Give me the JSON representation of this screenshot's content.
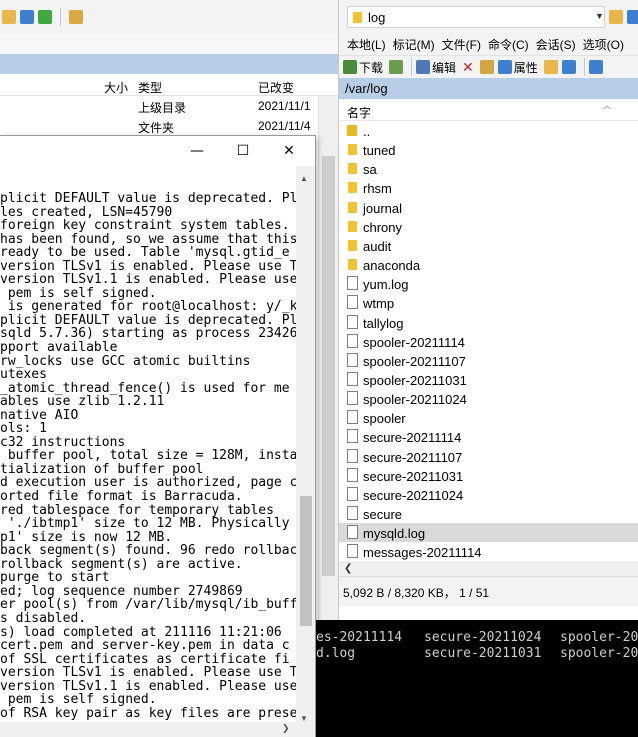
{
  "left_browser": {
    "columns": {
      "size": "大小",
      "type": "类型",
      "modified": "已改变"
    },
    "rows": [
      {
        "type": "上级目录",
        "modified": "2021/11/1"
      },
      {
        "type": "文件夹",
        "modified": "2021/11/4"
      }
    ]
  },
  "console": {
    "minimize_glyph": "—",
    "maximize_glyph": "☐",
    "close_glyph": "✕",
    "lines": [
      "plicit DEFAULT value is deprecated. Pl",
      "les created, LSN=45790",
      "foreign key constraint system tables.",
      "has been found, so we assume that this",
      "ready to be used. Table 'mysql.gtid_e",
      "version TLSv1 is enabled. Please use T",
      "version TLSv1.1 is enabled. Please use",
      " pem is self signed.",
      " is generated for root@localhost: y/_k",
      "plicit DEFAULT value is deprecated. Pl",
      "sqld 5.7.36) starting as process 23426",
      "pport available",
      "rw_locks use GCC atomic builtins",
      "utexes",
      "_atomic_thread_fence() is used for me",
      "ables use zlib 1.2.11",
      "native AIO",
      "ols: 1",
      "c32 instructions",
      " buffer pool, total size = 128M, insta",
      "tialization of buffer pool",
      "d execution user is authorized, page c",
      "orted file format is Barracuda.",
      "red tablespace for temporary tables",
      " './ibtmp1' size to 12 MB. Physically",
      "p1' size is now 12 MB.",
      "back segment(s) found. 96 redo rollbac",
      "rollback segment(s) are active.",
      "purge to start",
      "ed; log sequence number 2749869",
      "er pool(s) from /var/lib/mysql/ib_buff",
      "s disabled.",
      "s) load completed at 211116 11:21:06",
      "cert.pem and server-key.pem in data c",
      "of SSL certificates as certificate fi",
      "version TLSv1 is enabled. Please use T",
      "version TLSv1.1 is enabled. Please use",
      " pem is self signed.",
      "of RSA key pair as key files are prese"
    ]
  },
  "remote_browser": {
    "address": "log",
    "menu": [
      "本地(L)",
      "标记(M)",
      "文件(F)",
      "命令(C)",
      "会话(S)",
      "选项(O)"
    ],
    "actions": {
      "download": "下载",
      "edit": "编辑",
      "properties": "属性"
    },
    "path": "/var/log",
    "column_name": "名字",
    "files": [
      {
        "name": "..",
        "kind": "up"
      },
      {
        "name": "tuned",
        "kind": "folder"
      },
      {
        "name": "sa",
        "kind": "folder"
      },
      {
        "name": "rhsm",
        "kind": "folder"
      },
      {
        "name": "journal",
        "kind": "folder"
      },
      {
        "name": "chrony",
        "kind": "folder"
      },
      {
        "name": "audit",
        "kind": "folder"
      },
      {
        "name": "anaconda",
        "kind": "folder"
      },
      {
        "name": "yum.log",
        "kind": "file"
      },
      {
        "name": "wtmp",
        "kind": "file"
      },
      {
        "name": "tallylog",
        "kind": "file"
      },
      {
        "name": "spooler-20211114",
        "kind": "file"
      },
      {
        "name": "spooler-20211107",
        "kind": "file"
      },
      {
        "name": "spooler-20211031",
        "kind": "file"
      },
      {
        "name": "spooler-20211024",
        "kind": "file"
      },
      {
        "name": "spooler",
        "kind": "file"
      },
      {
        "name": "secure-20211114",
        "kind": "file"
      },
      {
        "name": "secure-20211107",
        "kind": "file"
      },
      {
        "name": "secure-20211031",
        "kind": "file"
      },
      {
        "name": "secure-20211024",
        "kind": "file"
      },
      {
        "name": "secure",
        "kind": "file"
      },
      {
        "name": "mysqld.log",
        "kind": "file",
        "selected": true
      },
      {
        "name": "messages-20211114",
        "kind": "file"
      }
    ],
    "status": "5,092 B / 8,320 KB， 1 / 51"
  },
  "terminal": {
    "rows": [
      [
        "es-20211114",
        "secure-20211024",
        "spooler-20"
      ],
      [
        "d.log",
        "secure-20211031",
        "spooler-20"
      ]
    ]
  },
  "colors": {
    "selection_blue": "#b8cde6",
    "folder_yellow": "#f2c230",
    "selected_row": "#d9d9d9",
    "terminal_bg": "#000000"
  }
}
